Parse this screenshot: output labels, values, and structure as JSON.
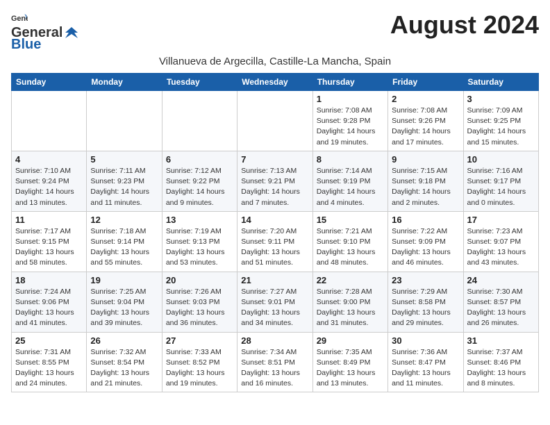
{
  "logo": {
    "general": "General",
    "blue": "Blue"
  },
  "title": "August 2024",
  "location": "Villanueva de Argecilla, Castille-La Mancha, Spain",
  "days_of_week": [
    "Sunday",
    "Monday",
    "Tuesday",
    "Wednesday",
    "Thursday",
    "Friday",
    "Saturday"
  ],
  "weeks": [
    [
      {
        "day": "",
        "info": ""
      },
      {
        "day": "",
        "info": ""
      },
      {
        "day": "",
        "info": ""
      },
      {
        "day": "",
        "info": ""
      },
      {
        "day": "1",
        "info": "Sunrise: 7:08 AM\nSunset: 9:28 PM\nDaylight: 14 hours\nand 19 minutes."
      },
      {
        "day": "2",
        "info": "Sunrise: 7:08 AM\nSunset: 9:26 PM\nDaylight: 14 hours\nand 17 minutes."
      },
      {
        "day": "3",
        "info": "Sunrise: 7:09 AM\nSunset: 9:25 PM\nDaylight: 14 hours\nand 15 minutes."
      }
    ],
    [
      {
        "day": "4",
        "info": "Sunrise: 7:10 AM\nSunset: 9:24 PM\nDaylight: 14 hours\nand 13 minutes."
      },
      {
        "day": "5",
        "info": "Sunrise: 7:11 AM\nSunset: 9:23 PM\nDaylight: 14 hours\nand 11 minutes."
      },
      {
        "day": "6",
        "info": "Sunrise: 7:12 AM\nSunset: 9:22 PM\nDaylight: 14 hours\nand 9 minutes."
      },
      {
        "day": "7",
        "info": "Sunrise: 7:13 AM\nSunset: 9:21 PM\nDaylight: 14 hours\nand 7 minutes."
      },
      {
        "day": "8",
        "info": "Sunrise: 7:14 AM\nSunset: 9:19 PM\nDaylight: 14 hours\nand 4 minutes."
      },
      {
        "day": "9",
        "info": "Sunrise: 7:15 AM\nSunset: 9:18 PM\nDaylight: 14 hours\nand 2 minutes."
      },
      {
        "day": "10",
        "info": "Sunrise: 7:16 AM\nSunset: 9:17 PM\nDaylight: 14 hours\nand 0 minutes."
      }
    ],
    [
      {
        "day": "11",
        "info": "Sunrise: 7:17 AM\nSunset: 9:15 PM\nDaylight: 13 hours\nand 58 minutes."
      },
      {
        "day": "12",
        "info": "Sunrise: 7:18 AM\nSunset: 9:14 PM\nDaylight: 13 hours\nand 55 minutes."
      },
      {
        "day": "13",
        "info": "Sunrise: 7:19 AM\nSunset: 9:13 PM\nDaylight: 13 hours\nand 53 minutes."
      },
      {
        "day": "14",
        "info": "Sunrise: 7:20 AM\nSunset: 9:11 PM\nDaylight: 13 hours\nand 51 minutes."
      },
      {
        "day": "15",
        "info": "Sunrise: 7:21 AM\nSunset: 9:10 PM\nDaylight: 13 hours\nand 48 minutes."
      },
      {
        "day": "16",
        "info": "Sunrise: 7:22 AM\nSunset: 9:09 PM\nDaylight: 13 hours\nand 46 minutes."
      },
      {
        "day": "17",
        "info": "Sunrise: 7:23 AM\nSunset: 9:07 PM\nDaylight: 13 hours\nand 43 minutes."
      }
    ],
    [
      {
        "day": "18",
        "info": "Sunrise: 7:24 AM\nSunset: 9:06 PM\nDaylight: 13 hours\nand 41 minutes."
      },
      {
        "day": "19",
        "info": "Sunrise: 7:25 AM\nSunset: 9:04 PM\nDaylight: 13 hours\nand 39 minutes."
      },
      {
        "day": "20",
        "info": "Sunrise: 7:26 AM\nSunset: 9:03 PM\nDaylight: 13 hours\nand 36 minutes."
      },
      {
        "day": "21",
        "info": "Sunrise: 7:27 AM\nSunset: 9:01 PM\nDaylight: 13 hours\nand 34 minutes."
      },
      {
        "day": "22",
        "info": "Sunrise: 7:28 AM\nSunset: 9:00 PM\nDaylight: 13 hours\nand 31 minutes."
      },
      {
        "day": "23",
        "info": "Sunrise: 7:29 AM\nSunset: 8:58 PM\nDaylight: 13 hours\nand 29 minutes."
      },
      {
        "day": "24",
        "info": "Sunrise: 7:30 AM\nSunset: 8:57 PM\nDaylight: 13 hours\nand 26 minutes."
      }
    ],
    [
      {
        "day": "25",
        "info": "Sunrise: 7:31 AM\nSunset: 8:55 PM\nDaylight: 13 hours\nand 24 minutes."
      },
      {
        "day": "26",
        "info": "Sunrise: 7:32 AM\nSunset: 8:54 PM\nDaylight: 13 hours\nand 21 minutes."
      },
      {
        "day": "27",
        "info": "Sunrise: 7:33 AM\nSunset: 8:52 PM\nDaylight: 13 hours\nand 19 minutes."
      },
      {
        "day": "28",
        "info": "Sunrise: 7:34 AM\nSunset: 8:51 PM\nDaylight: 13 hours\nand 16 minutes."
      },
      {
        "day": "29",
        "info": "Sunrise: 7:35 AM\nSunset: 8:49 PM\nDaylight: 13 hours\nand 13 minutes."
      },
      {
        "day": "30",
        "info": "Sunrise: 7:36 AM\nSunset: 8:47 PM\nDaylight: 13 hours\nand 11 minutes."
      },
      {
        "day": "31",
        "info": "Sunrise: 7:37 AM\nSunset: 8:46 PM\nDaylight: 13 hours\nand 8 minutes."
      }
    ]
  ]
}
